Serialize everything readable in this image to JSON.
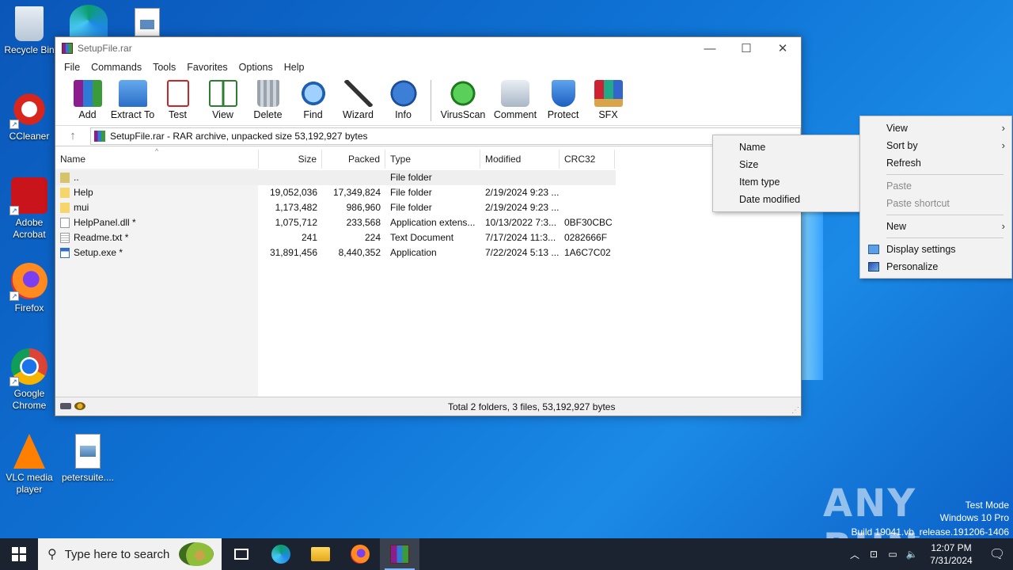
{
  "desktop": {
    "icons": [
      {
        "label": "Recycle Bin"
      },
      {
        "label": "CCleaner"
      },
      {
        "label": "Adobe Acrobat"
      },
      {
        "label": "Firefox"
      },
      {
        "label": "Google Chrome"
      },
      {
        "label": "VLC media player"
      },
      {
        "label": "petersuite...."
      }
    ]
  },
  "window": {
    "title": "SetupFile.rar",
    "controls": [
      "—",
      "☐",
      "✕"
    ],
    "menu": [
      "File",
      "Commands",
      "Tools",
      "Favorites",
      "Options",
      "Help"
    ],
    "toolbar": [
      "Add",
      "Extract To",
      "Test",
      "View",
      "Delete",
      "Find",
      "Wizard",
      "Info",
      "VirusScan",
      "Comment",
      "Protect",
      "SFX"
    ],
    "address": "SetupFile.rar - RAR archive, unpacked size 53,192,927 bytes",
    "columns": [
      "Name",
      "Size",
      "Packed",
      "Type",
      "Modified",
      "CRC32"
    ],
    "files": [
      {
        "name": "..",
        "size": "",
        "packed": "",
        "type": "File folder",
        "modified": "",
        "crc": ""
      },
      {
        "name": "Help",
        "size": "19,052,036",
        "packed": "17,349,824",
        "type": "File folder",
        "modified": "2/19/2024 9:23 ...",
        "crc": ""
      },
      {
        "name": "mui",
        "size": "1,173,482",
        "packed": "986,960",
        "type": "File folder",
        "modified": "2/19/2024 9:23 ...",
        "crc": ""
      },
      {
        "name": "HelpPanel.dll *",
        "size": "1,075,712",
        "packed": "233,568",
        "type": "Application extens...",
        "modified": "10/13/2022 7:3...",
        "crc": "0BF30CBC"
      },
      {
        "name": "Readme.txt *",
        "size": "241",
        "packed": "224",
        "type": "Text Document",
        "modified": "7/17/2024 11:3...",
        "crc": "0282666F"
      },
      {
        "name": "Setup.exe *",
        "size": "31,891,456",
        "packed": "8,440,352",
        "type": "Application",
        "modified": "7/22/2024 5:13 ...",
        "crc": "1A6C7C02"
      }
    ],
    "status": "Total 2 folders, 3 files, 53,192,927 bytes"
  },
  "sort_menu": [
    "Name",
    "Size",
    "Item type",
    "Date modified"
  ],
  "context_menu": {
    "view": "View",
    "sort_by": "Sort by",
    "refresh": "Refresh",
    "paste": "Paste",
    "paste_shortcut": "Paste shortcut",
    "new": "New",
    "display_settings": "Display settings",
    "personalize": "Personalize"
  },
  "taskbar": {
    "search_placeholder": "Type here to search",
    "time": "12:07 PM",
    "date": "7/31/2024"
  },
  "watermark": {
    "line1": "Test Mode",
    "line2": "Windows 10 Pro",
    "line3": "Build 19041.vb_release.191206-1406",
    "brand": "ANY RUN"
  }
}
